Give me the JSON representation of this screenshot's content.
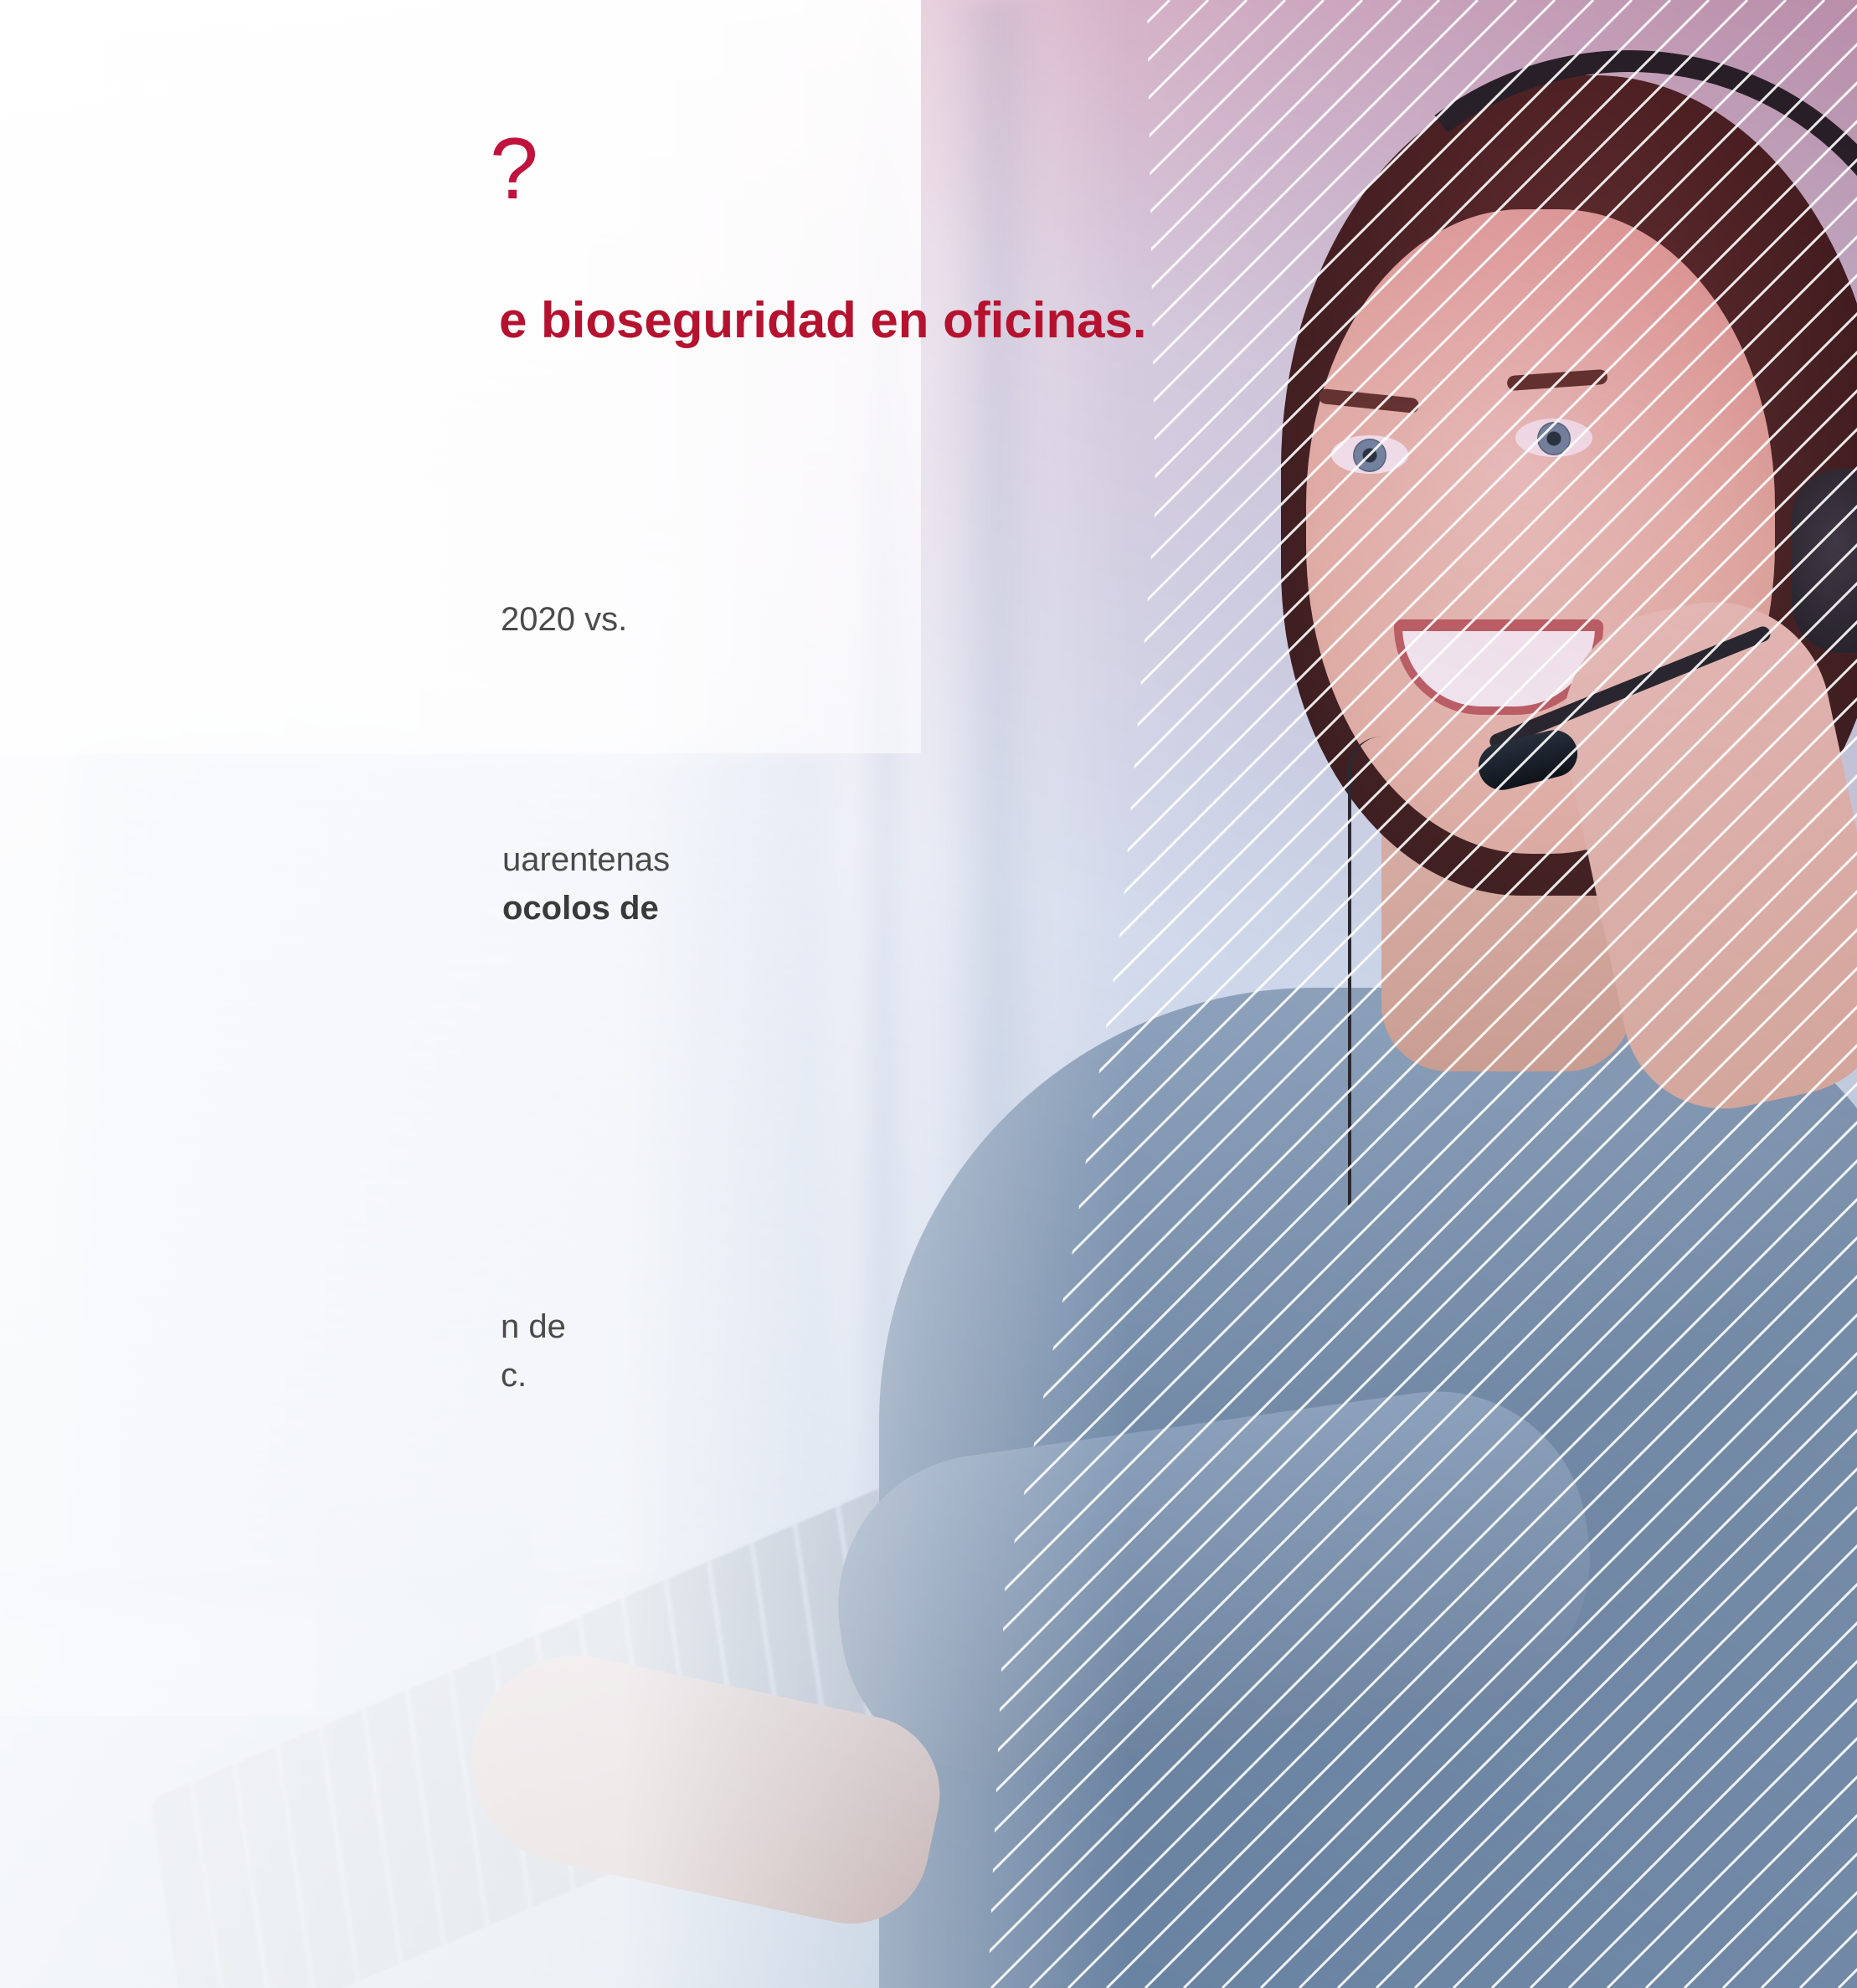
{
  "slide": {
    "title_fragment": "?",
    "subtitle_fragment": "e bioseguridad en oficinas.",
    "paragraphs": [
      {
        "lines": [
          "2020 vs."
        ]
      },
      {
        "lines": [
          "uarentenas"
        ],
        "bold_lines": [
          "ocolos de"
        ]
      },
      {
        "lines": [
          "n de",
          "c."
        ]
      }
    ]
  },
  "photo": {
    "subject": "woman-with-headset-at-keyboard-icon"
  },
  "colors": {
    "accent_red": "#c0123c",
    "subtitle_red": "#b5122f",
    "body_text": "#4a4a4a",
    "overlay_pink": "#be285a",
    "overlay_blue": "#3c6eaa",
    "stripe": "#ffffff"
  }
}
